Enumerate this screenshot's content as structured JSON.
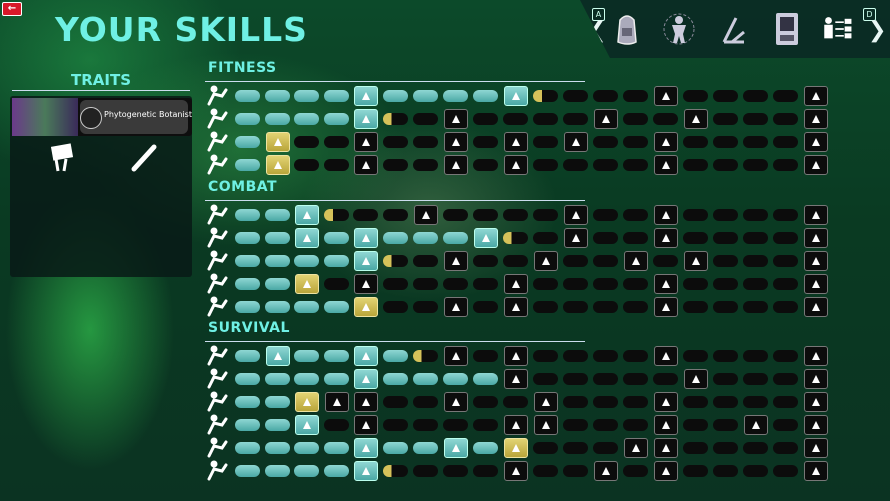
{
  "header": {
    "title": "YOUR SKILLS",
    "back_label": "←",
    "key_left": "A",
    "key_right": "D",
    "arrow_left": "❮",
    "arrow_right": "❯",
    "tabs": [
      {
        "name": "backpack-icon"
      },
      {
        "name": "body-icon"
      },
      {
        "name": "tools-icon"
      },
      {
        "name": "device-icon"
      },
      {
        "name": "skills-tree-icon"
      }
    ]
  },
  "traits": {
    "title": "TRAITS",
    "card_name": "Phytogenetic Botanist",
    "extra_icons": [
      "shield-pack-icon",
      "bat-icon"
    ]
  },
  "sections": [
    {
      "title": "FITNESS",
      "rows": [
        {
          "icon": "running-icon",
          "progress": [
            "f",
            "f",
            "f",
            "f",
            "T",
            "f",
            "f",
            "f",
            "f",
            "T",
            "p",
            "e",
            "e",
            "e",
            "D",
            "e",
            "e",
            "e",
            "e",
            "D"
          ]
        },
        {
          "icon": "strength-icon",
          "progress": [
            "f",
            "f",
            "f",
            "f",
            "T",
            "p",
            "e",
            "D",
            "e",
            "e",
            "e",
            "e",
            "D",
            "e",
            "e",
            "D",
            "e",
            "e",
            "e",
            "D"
          ]
        },
        {
          "icon": "sprint-icon",
          "progress": [
            "f",
            "G",
            "e",
            "e",
            "D",
            "e",
            "e",
            "D",
            "e",
            "D",
            "e",
            "D",
            "e",
            "e",
            "D",
            "e",
            "e",
            "e",
            "e",
            "D"
          ]
        },
        {
          "icon": "stealth-icon",
          "progress": [
            "f",
            "G",
            "e",
            "e",
            "D",
            "e",
            "e",
            "D",
            "e",
            "D",
            "e",
            "e",
            "e",
            "e",
            "D",
            "e",
            "e",
            "e",
            "e",
            "D"
          ]
        }
      ]
    },
    {
      "title": "COMBAT",
      "rows": [
        {
          "icon": "bat-icon",
          "progress": [
            "f",
            "f",
            "T",
            "p",
            "e",
            "e",
            "D",
            "e",
            "e",
            "e",
            "e",
            "D",
            "e",
            "e",
            "D",
            "e",
            "e",
            "e",
            "e",
            "D"
          ]
        },
        {
          "icon": "blade-icon",
          "progress": [
            "f",
            "f",
            "T",
            "f",
            "T",
            "f",
            "f",
            "f",
            "T",
            "p",
            "e",
            "D",
            "e",
            "e",
            "D",
            "e",
            "e",
            "e",
            "e",
            "D"
          ]
        },
        {
          "icon": "aim-icon",
          "progress": [
            "f",
            "f",
            "f",
            "f",
            "T",
            "p",
            "e",
            "D",
            "e",
            "e",
            "D",
            "e",
            "e",
            "D",
            "e",
            "D",
            "e",
            "e",
            "e",
            "D"
          ]
        },
        {
          "icon": "throw-icon",
          "progress": [
            "f",
            "f",
            "G",
            "e",
            "D",
            "e",
            "e",
            "e",
            "e",
            "D",
            "e",
            "e",
            "e",
            "e",
            "D",
            "e",
            "e",
            "e",
            "e",
            "D"
          ]
        },
        {
          "icon": "melee-icon",
          "progress": [
            "f",
            "f",
            "f",
            "f",
            "G",
            "e",
            "e",
            "D",
            "e",
            "D",
            "e",
            "e",
            "e",
            "e",
            "D",
            "e",
            "e",
            "e",
            "e",
            "D"
          ]
        }
      ]
    },
    {
      "title": "SURVIVAL",
      "rows": [
        {
          "icon": "crafting-icon",
          "progress": [
            "f",
            "T",
            "f",
            "f",
            "T",
            "f",
            "p",
            "D",
            "e",
            "D",
            "e",
            "e",
            "e",
            "e",
            "D",
            "e",
            "e",
            "e",
            "e",
            "D"
          ]
        },
        {
          "icon": "building-icon",
          "progress": [
            "f",
            "f",
            "f",
            "f",
            "T",
            "f",
            "f",
            "f",
            "f",
            "D",
            "e",
            "e",
            "e",
            "e",
            "e",
            "D",
            "e",
            "e",
            "e",
            "D"
          ]
        },
        {
          "icon": "medical-icon",
          "progress": [
            "f",
            "f",
            "G",
            "D",
            "D",
            "e",
            "e",
            "D",
            "e",
            "e",
            "D",
            "e",
            "e",
            "e",
            "D",
            "e",
            "e",
            "e",
            "e",
            "D"
          ]
        },
        {
          "icon": "cooking-icon",
          "progress": [
            "f",
            "f",
            "T",
            "e",
            "D",
            "e",
            "e",
            "e",
            "e",
            "D",
            "D",
            "e",
            "e",
            "e",
            "D",
            "e",
            "e",
            "D",
            "e",
            "D"
          ]
        },
        {
          "icon": "farming-icon",
          "progress": [
            "f",
            "f",
            "f",
            "f",
            "T",
            "f",
            "f",
            "T",
            "f",
            "G",
            "e",
            "e",
            "e",
            "D",
            "D",
            "e",
            "e",
            "e",
            "e",
            "D"
          ]
        },
        {
          "icon": "foraging-icon",
          "progress": [
            "f",
            "f",
            "f",
            "f",
            "T",
            "p",
            "e",
            "e",
            "e",
            "D",
            "e",
            "e",
            "D",
            "e",
            "D",
            "e",
            "e",
            "e",
            "e",
            "D"
          ]
        }
      ]
    }
  ]
}
